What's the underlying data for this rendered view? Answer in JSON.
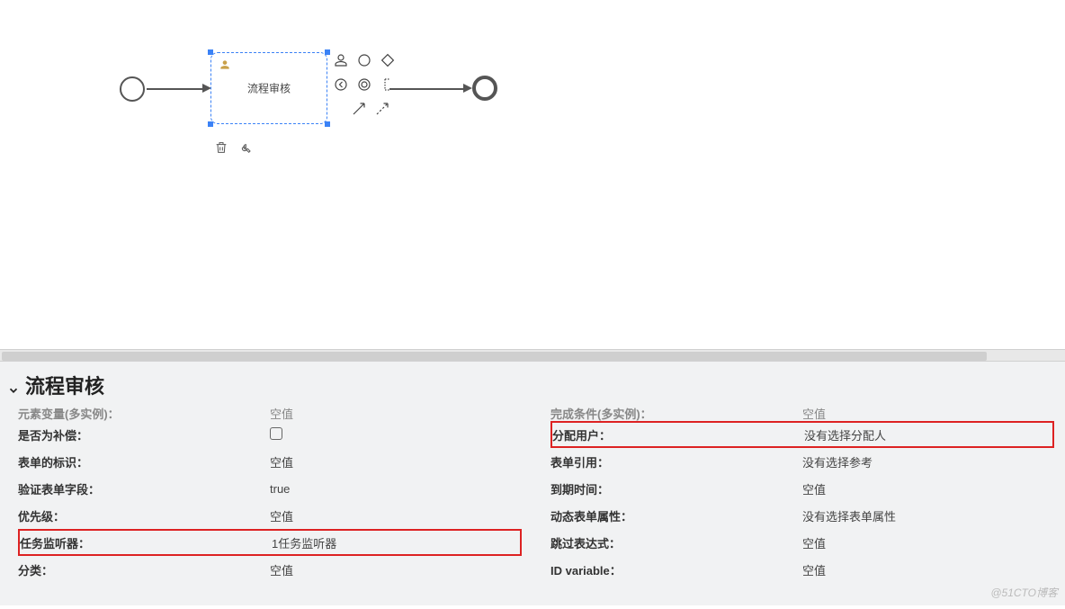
{
  "diagram": {
    "task_label": "流程审核",
    "tool_icons": {
      "delete": "trash-icon",
      "edit": "wrench-icon"
    },
    "palette": [
      [
        "user-icon",
        "circle-icon",
        "diamond-icon"
      ],
      [
        "back-circle-icon",
        "double-circle-icon",
        "annotation-icon"
      ],
      [
        "",
        "arrow-icon",
        "dashed-arrow-icon"
      ]
    ]
  },
  "panel": {
    "title": "流程审核",
    "left": {
      "truncated": {
        "label": "元素变量(多实例)：",
        "value": "空值"
      },
      "rows": [
        {
          "label": "是否为补偿：",
          "value_type": "checkbox"
        },
        {
          "label": "表单的标识：",
          "value": "空值"
        },
        {
          "label": "验证表单字段：",
          "value": "true"
        },
        {
          "label": "优先级：",
          "value": "空值"
        },
        {
          "label": "任务监听器：",
          "value": "1任务监听器",
          "highlighted": true
        },
        {
          "label": "分类：",
          "value": "空值"
        }
      ]
    },
    "right": {
      "truncated": {
        "label": "完成条件(多实例)：",
        "value": "空值"
      },
      "rows": [
        {
          "label": "分配用户：",
          "value": "没有选择分配人",
          "highlighted": true
        },
        {
          "label": "表单引用：",
          "value": "没有选择参考"
        },
        {
          "label": "到期时间：",
          "value": "空值"
        },
        {
          "label": "动态表单属性：",
          "value": "没有选择表单属性"
        },
        {
          "label": "跳过表达式：",
          "value": "空值"
        },
        {
          "label": "ID variable：",
          "value": "空值"
        }
      ]
    }
  },
  "watermark": "@51CTO博客"
}
